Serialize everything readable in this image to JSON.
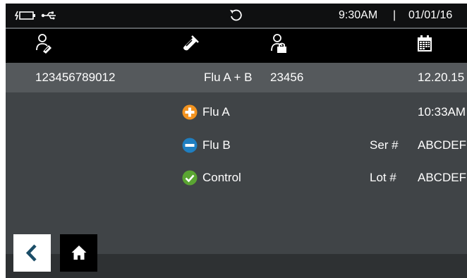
{
  "status": {
    "time": "9:30AM",
    "separator": "|",
    "date": "01/01/16"
  },
  "icons": {
    "status_left": [
      "battery-charging-icon",
      "usb-icon"
    ],
    "status_center": "refresh-icon",
    "header": [
      "patient-sample-icon",
      "test-tube-icon",
      "operator-icon",
      "calendar-icon"
    ],
    "results": [
      "positive-icon",
      "negative-icon",
      "control-pass-icon"
    ],
    "nav": [
      "back-chevron-icon",
      "home-icon"
    ]
  },
  "record": {
    "sample_id": "123456789012",
    "test_name": "Flu A + B",
    "operator_id": "23456",
    "date": "12.20.15",
    "time": "10:33AM"
  },
  "results": [
    {
      "label": "Flu A",
      "status": "positive"
    },
    {
      "label": "Flu B",
      "status": "negative"
    },
    {
      "label": "Control",
      "status": "pass"
    }
  ],
  "device": {
    "serial_label": "Ser #",
    "serial_value": "ABCDEF",
    "lot_label": "Lot #",
    "lot_value": "ABCDEF"
  },
  "colors": {
    "positive": "#f29320",
    "negative": "#1f7fc1",
    "pass": "#5aa532",
    "background": "#404447",
    "header_bar": "#000000",
    "nav_accent": "#1b4d67"
  }
}
